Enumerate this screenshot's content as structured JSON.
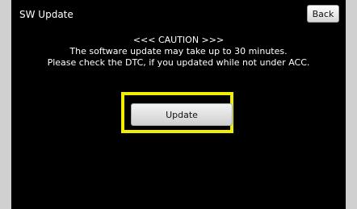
{
  "header": {
    "title": "SW Update",
    "back_label": "Back"
  },
  "message": {
    "line1": "<<< CAUTION >>>",
    "line2": "The software update may take up to 30 minutes.",
    "line3": "Please check the DTC, if you updated while not under ACC."
  },
  "actions": {
    "update_label": "Update"
  },
  "colors": {
    "screen_bg": "#000000",
    "highlight": "#f2ee00",
    "frame_bg": "#d0d0d0"
  }
}
